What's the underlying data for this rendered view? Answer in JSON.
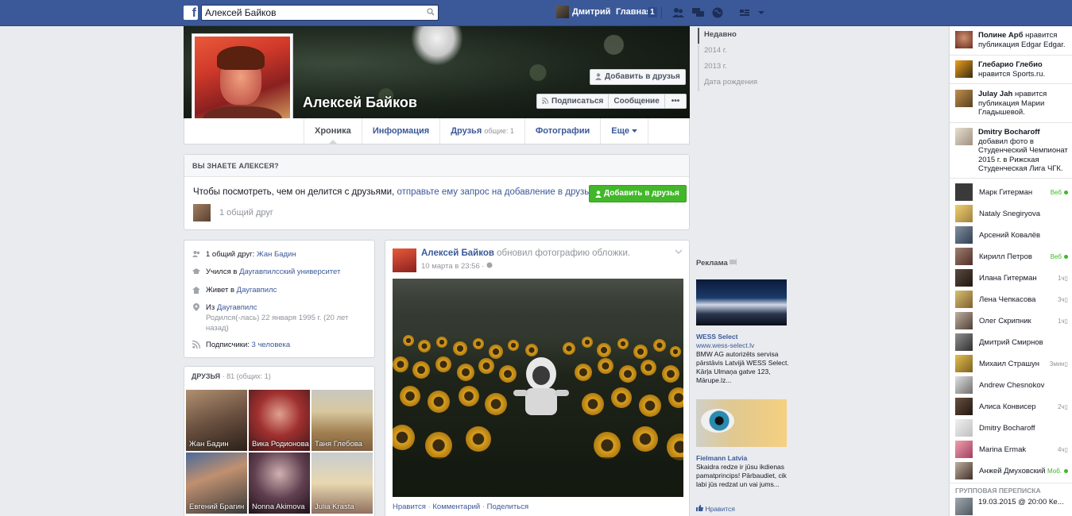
{
  "topbar": {
    "search_value": "Алексей Байков",
    "user_name": "Дмитрий",
    "home_label": "Главная",
    "home_count": "1",
    "brand_color": "#3b5998"
  },
  "profile": {
    "name": "Алексей Байков",
    "add_friend": "Добавить в друзья",
    "subscribe": "Подписаться",
    "message": "Сообщение",
    "more": "•••"
  },
  "tabs": {
    "timeline": "Хроника",
    "info": "Информация",
    "friends": "Друзья",
    "friends_sub": "общие: 1",
    "photos": "Фотографии",
    "more": "Еще"
  },
  "know": {
    "title": "ВЫ ЗНАЕТЕ АЛЕКСЕЯ?",
    "text": "Чтобы посмотреть, чем он делится с друзьями,",
    "link": "отправьте ему запрос на добавление в друзья.",
    "button": "Добавить в друзья",
    "mutual": "1 общий друг"
  },
  "years": [
    "Недавно",
    "2014 г.",
    "2013 г.",
    "Дата рождения"
  ],
  "intro": {
    "mutual_prefix": "1 общий друг:",
    "mutual_name": "Жан Бадин",
    "study_prefix": "Учился в",
    "study_place": "Даугавпилсский университет",
    "lives_prefix": "Живет в",
    "lives_place": "Даугавпилс",
    "from_prefix": "Из",
    "from_place": "Даугавпилс",
    "born": "Родился(-лась) 22 января 1995 г. (20 лет назад)",
    "followers_prefix": "Подписчики:",
    "followers": "3 человека"
  },
  "friends": {
    "title": "ДРУЗЬЯ",
    "count": "· 81 (общих: 1)",
    "items": [
      {
        "name": "Жан Бадин"
      },
      {
        "name": "Вика Родионова"
      },
      {
        "name": "Таня Глебова"
      },
      {
        "name": "Евгений Брагин"
      },
      {
        "name": "Nonna Akimova"
      },
      {
        "name": "Julia Krasta"
      }
    ]
  },
  "post": {
    "author": "Алексей Байков",
    "action": "обновил фотографию обложки.",
    "time": "10 марта в 23:56 ·",
    "like": "Нравится",
    "comment": "Комментарий",
    "share": "Поделиться"
  },
  "ads": {
    "title": "Реклама",
    "ad1_title": "WESS Select",
    "ad1_url": "www.wess-select.lv",
    "ad1_text": "BMW AG autorizēts servisa pārstāvis Latvijā WESS Select. Kārļa Ulmaņa gatve 123, Mārupe.lz...",
    "ad2_title": "Fielmann Latvia",
    "ad2_text": "Skaidra redze ir jūsu ikdienas pamatprincips! Pārbaudiet, cik labi jūs redzat un vai jums...",
    "ad2_like": "Нравится"
  },
  "ticker": [
    {
      "name": "Полине Арб",
      "text": "нравится публикация Edgar Edgar."
    },
    {
      "name": "Глебарио Глебио",
      "text": "нравится Sports.ru."
    },
    {
      "name": "Julay Jah",
      "text": "нравится публикация Марии Гладышевой."
    },
    {
      "name": "Dmitry Bocharoff",
      "text": "добавил фото в Студенческий Чемпионат 2015 г. в Рижская Студенческая Лига ЧГК."
    }
  ],
  "chat": [
    {
      "name": "Марк Гитерман",
      "status": "Веб",
      "online": true
    },
    {
      "name": "Nataly Snegiryova",
      "status": "",
      "online": false
    },
    {
      "name": "Арсений Ковалёв",
      "status": "",
      "online": false
    },
    {
      "name": "Кирилл Петров",
      "status": "Веб",
      "online": true
    },
    {
      "name": "Илана Гитерман",
      "status": "1ч",
      "online": false
    },
    {
      "name": "Лена Чепкасова",
      "status": "3ч",
      "online": false
    },
    {
      "name": "Олег Скрипник",
      "status": "1ч",
      "online": false
    },
    {
      "name": "Дмитрий Смирнов",
      "status": "",
      "online": false
    },
    {
      "name": "Михаил Страшун",
      "status": "3мин",
      "online": false
    },
    {
      "name": "Andrew Chesnokov",
      "status": "",
      "online": false
    },
    {
      "name": "Алиса Конвисер",
      "status": "2ч",
      "online": false
    },
    {
      "name": "Dmitry Bocharoff",
      "status": "",
      "online": false
    },
    {
      "name": "Marina Ermak",
      "status": "4ч",
      "online": false
    },
    {
      "name": "Анжей Дмуховский",
      "status": "Моб.",
      "online": true
    }
  ],
  "group": {
    "title": "ГРУППОВАЯ ПЕРЕПИСКА",
    "item": "19.03.2015 @ 20:00 Ке..."
  }
}
